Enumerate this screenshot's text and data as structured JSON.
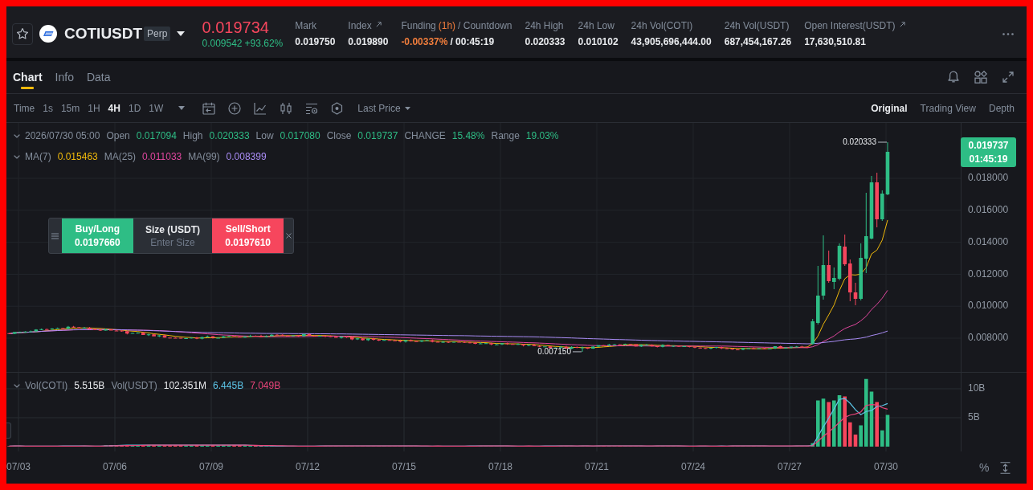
{
  "header": {
    "symbol": "COTIUSDT",
    "badge": "Perp",
    "last_price": "0.019734",
    "change": "0.009542",
    "change_percent": "+93.62%",
    "stats": [
      {
        "kind": "plain",
        "label": "Mark",
        "value": "0.019750",
        "external_link": false
      },
      {
        "kind": "plain",
        "label": "Index",
        "value": "0.019890",
        "external_link": true
      },
      {
        "kind": "funding",
        "label": "Funding",
        "interval": "(1h)",
        "label_suffix": "/ Countdown",
        "value": "-0.00337%",
        "countdown": "/ 00:45:19",
        "external_link": false
      },
      {
        "kind": "plain",
        "label": "24h High",
        "value": "0.020333",
        "external_link": false
      },
      {
        "kind": "plain",
        "label": "24h Low",
        "value": "0.010102",
        "external_link": false
      },
      {
        "kind": "plain",
        "label": "24h Vol(COTI)",
        "value": "43,905,696,444.00",
        "external_link": false
      },
      {
        "kind": "plain",
        "label": "24h Vol(USDT)",
        "value": "687,454,167.26",
        "external_link": false
      },
      {
        "kind": "plain",
        "label": "Open Interest(USDT)",
        "value": "17,630,510.81",
        "external_link": true
      }
    ]
  },
  "tabs": [
    {
      "label": "Chart",
      "selected": true
    },
    {
      "label": "Info",
      "selected": false
    },
    {
      "label": "Data",
      "selected": false
    }
  ],
  "toolbar": {
    "time_label": "Time",
    "intervals": [
      {
        "label": "1s",
        "selected": false
      },
      {
        "label": "15m",
        "selected": false
      },
      {
        "label": "1H",
        "selected": false
      },
      {
        "label": "4H",
        "selected": true
      },
      {
        "label": "1D",
        "selected": false
      },
      {
        "label": "1W",
        "selected": false
      }
    ],
    "price_source": "Last Price",
    "views": [
      {
        "label": "Original",
        "selected": true
      },
      {
        "label": "Trading View",
        "selected": false
      },
      {
        "label": "Depth",
        "selected": false
      }
    ]
  },
  "chart": {
    "candle_time": "2026/07/30 05:00",
    "ohlc": [
      {
        "label": "Open",
        "value": "0.017094"
      },
      {
        "label": "High",
        "value": "0.020333"
      },
      {
        "label": "Low",
        "value": "0.017080"
      },
      {
        "label": "Close",
        "value": "0.019737"
      },
      {
        "label": "CHANGE",
        "value": "15.48%"
      },
      {
        "label": "Range",
        "value": "19.03%"
      }
    ],
    "moving_averages": [
      {
        "label": "MA(7)",
        "value": "0.015463",
        "color": "#f0b90b"
      },
      {
        "label": "MA(25)",
        "value": "0.011033",
        "color": "#e0479e"
      },
      {
        "label": "MA(99)",
        "value": "0.008399",
        "color": "#a98cf5"
      }
    ],
    "order_panel": {
      "buy_label": "Buy/Long",
      "buy_price": "0.0197660",
      "size_label": "Size (USDT)",
      "size_placeholder": "Enter Size",
      "sell_label": "Sell/Short",
      "sell_price": "0.0197610"
    },
    "high_marker": "0.020333",
    "low_marker": "0.007150",
    "current_price": "0.019737",
    "countdown": "01:45:19",
    "price_axis": [
      "0.018000",
      "0.016000",
      "0.014000",
      "0.012000",
      "0.010000",
      "0.008000"
    ]
  },
  "volume": {
    "fields": [
      {
        "label": "Vol(COTI)",
        "value": "5.515B"
      },
      {
        "label": "Vol(USDT)",
        "value": "102.351M"
      }
    ],
    "moving_averages": [
      {
        "value": "6.445B",
        "color": "#5cc4e6"
      },
      {
        "value": "7.049B",
        "color": "#e8457a"
      }
    ],
    "axis": [
      "10B",
      "5B"
    ]
  },
  "date_axis": [
    "07/03",
    "07/06",
    "07/09",
    "07/12",
    "07/15",
    "07/18",
    "07/21",
    "07/24",
    "07/27",
    "07/30"
  ],
  "scale_toggle": "%"
}
